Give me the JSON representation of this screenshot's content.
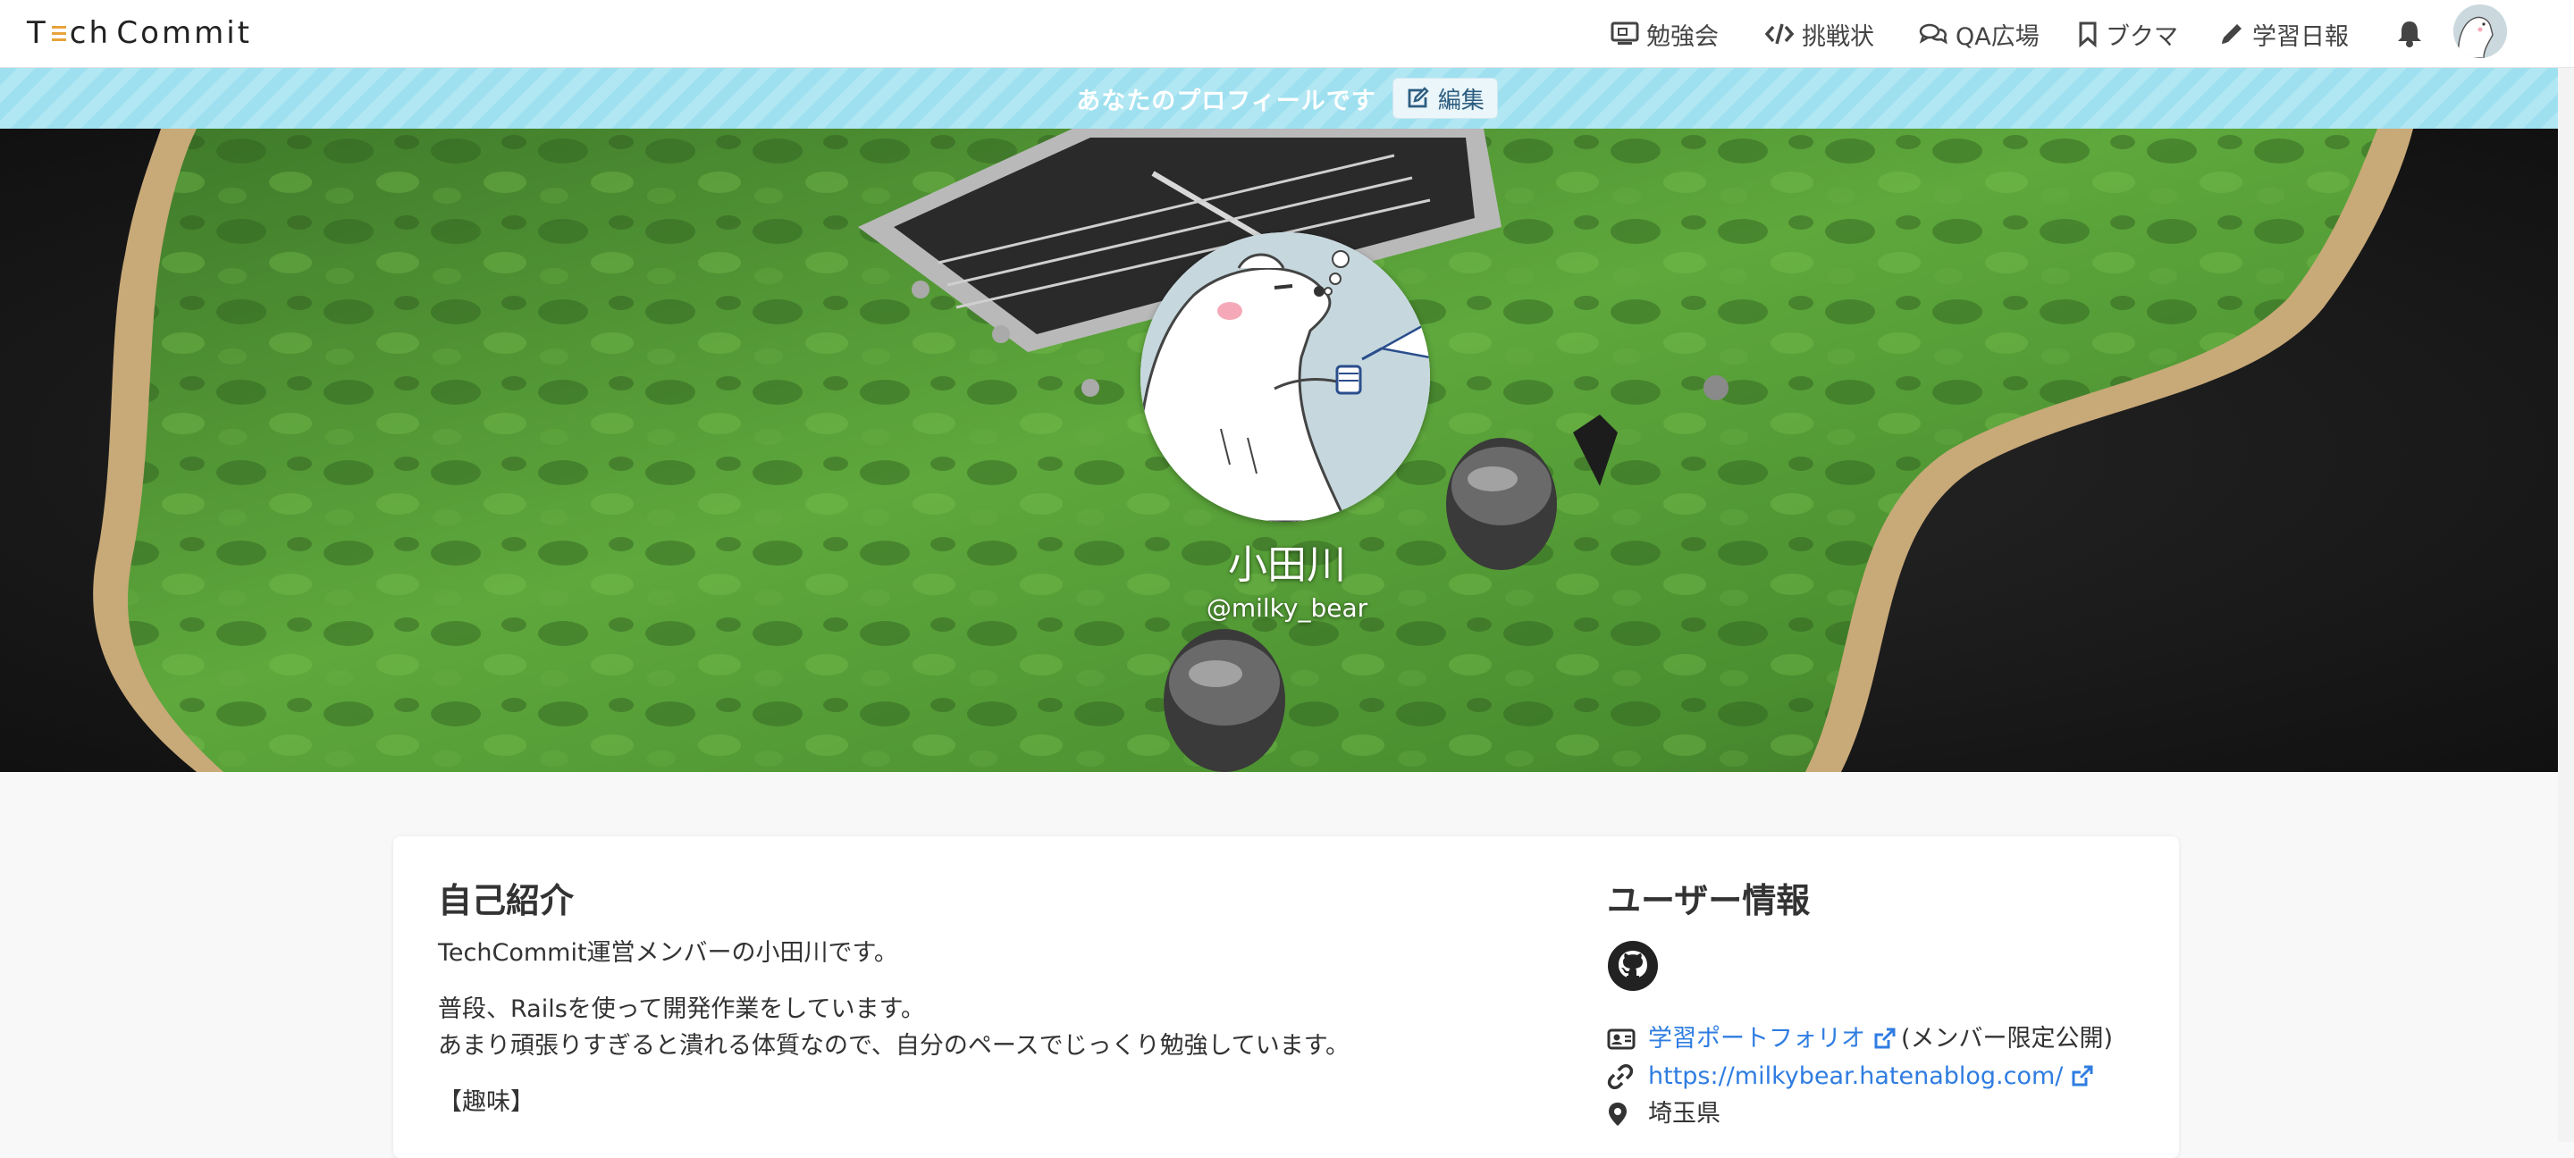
{
  "nav": {
    "logo": "TechCommit",
    "items": [
      {
        "label": "勉強会",
        "icon": "monitor-icon"
      },
      {
        "label": "挑戦状",
        "icon": "code-icon"
      },
      {
        "label": "QA広場",
        "icon": "chat-icon"
      },
      {
        "label": "ブクマ",
        "icon": "bookmark-icon"
      },
      {
        "label": "学習日報",
        "icon": "pencil-icon"
      }
    ],
    "notification_icon": "bell-icon",
    "avatar_icon": "user-avatar"
  },
  "banner": {
    "text": "あなたのプロフィールです",
    "edit_label": "編集"
  },
  "profile": {
    "name": "小田川",
    "handle": "@milky_bear"
  },
  "intro": {
    "title": "自己紹介",
    "line1": "TechCommit運営メンバーの小田川です。",
    "line2": "普段、Railsを使って開発作業をしています。",
    "line3": "あまり頑張りすぎると潰れる体質なので、自分のペースでじっくり勉強しています。",
    "line4": "【趣味】"
  },
  "userinfo": {
    "title": "ユーザー情報",
    "github_icon": "github-icon",
    "portfolio_label": "学習ポートフォリオ",
    "portfolio_note": "(メンバー限定公開)",
    "blog_url": "https://milkybear.hatenablog.com/",
    "location": "埼玉県"
  },
  "colors": {
    "banner": "#a7e3f1",
    "link": "#2f7de1",
    "logo_accent": "#e8a33a"
  }
}
